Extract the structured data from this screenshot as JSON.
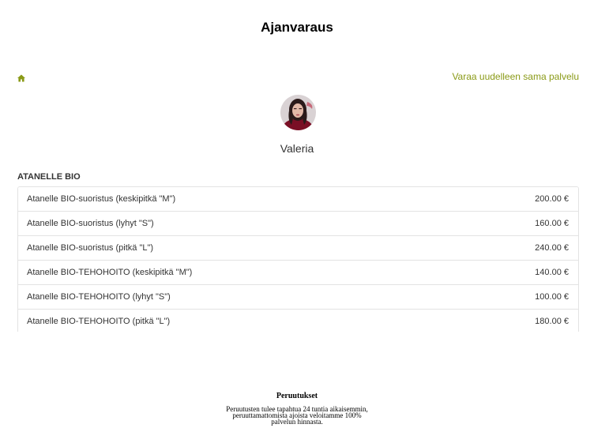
{
  "header": {
    "title": "Ajanvaraus"
  },
  "nav": {
    "home_icon": "home-icon",
    "rebook_label": "Varaa uudelleen sama palvelu"
  },
  "staff": {
    "name": "Valeria"
  },
  "category": {
    "title": "ATANELLE BIO",
    "services": [
      {
        "name": "Atanelle BIO-suoristus (keskipitkä \"M\")",
        "price": "200.00 €"
      },
      {
        "name": "Atanelle BIO-suoristus (lyhyt \"S\")",
        "price": "160.00 €"
      },
      {
        "name": "Atanelle BIO-suoristus (pitkä \"L\")",
        "price": "240.00 €"
      },
      {
        "name": "Atanelle BIO-TEHOHOITO (keskipitkä \"M\")",
        "price": "140.00 €"
      },
      {
        "name": "Atanelle BIO-TEHOHOITO (lyhyt \"S\")",
        "price": "100.00 €"
      },
      {
        "name": "Atanelle BIO-TEHOHOITO (pitkä \"L\")",
        "price": "180.00 €"
      }
    ]
  },
  "cancellation": {
    "title": "Peruutukset",
    "text": "Peruutusten tulee tapahtua 24 tuntia aikaisemmin, peruuttamattomista ajoista veloitamme 100% palvelun hinnasta."
  },
  "colors": {
    "accent": "#8a9a17",
    "border": "#e3e3e3",
    "text": "#333333"
  }
}
